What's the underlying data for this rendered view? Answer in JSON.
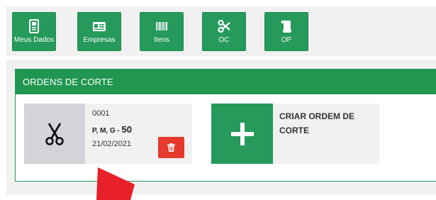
{
  "toolbar": {
    "items": [
      {
        "label": "Meus Dados",
        "icon": "id-badge-icon"
      },
      {
        "label": "Empresas",
        "icon": "id-card-icon"
      },
      {
        "label": "Itens",
        "icon": "barcode-icon"
      },
      {
        "label": "OC",
        "icon": "scissors-icon"
      },
      {
        "label": "OP",
        "icon": "scroll-icon"
      }
    ]
  },
  "panel": {
    "title": "ORDENS DE CORTE"
  },
  "order": {
    "number": "0001",
    "sizes": "P, M, G - ",
    "quantity": "50",
    "date": "21/02/2021",
    "icon": "scissors-icon",
    "delete_icon": "trash-icon"
  },
  "create": {
    "label": "CRIAR ORDEM DE CORTE",
    "icon": "plus-icon"
  },
  "colors": {
    "primary": "#259a5a",
    "header": "#219651",
    "danger": "#e53a2c",
    "annotation_arrow": "#e8202a",
    "card_bg": "#f1f1f1",
    "icon_bg": "#d2d4da"
  }
}
